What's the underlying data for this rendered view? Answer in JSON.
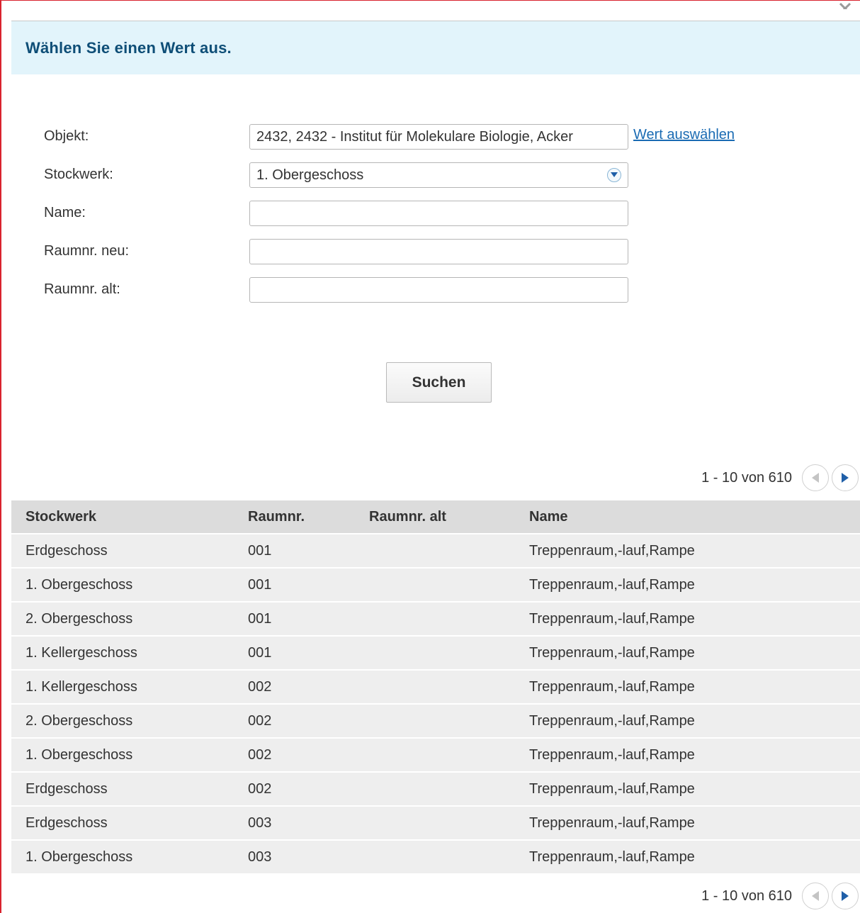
{
  "dialog": {
    "title": "Wählen Sie einen Wert aus."
  },
  "form": {
    "objekt": {
      "label": "Objekt:",
      "value": "2432, 2432 - Institut für Molekulare Biologie, Acker",
      "link": "Wert auswählen"
    },
    "stockwerk": {
      "label": "Stockwerk:",
      "value": "1. Obergeschoss"
    },
    "name": {
      "label": "Name:",
      "value": ""
    },
    "raumnr_neu": {
      "label": "Raumnr. neu:",
      "value": ""
    },
    "raumnr_alt": {
      "label": "Raumnr. alt:",
      "value": ""
    }
  },
  "search_button": "Suchen",
  "pager": {
    "text": "1 - 10 von 610"
  },
  "table": {
    "headers": [
      "Stockwerk",
      "Raumnr.",
      "Raumnr. alt",
      "Name"
    ],
    "rows": [
      [
        "Erdgeschoss",
        "001",
        "",
        "Treppenraum,-lauf,Rampe"
      ],
      [
        "1. Obergeschoss",
        "001",
        "",
        "Treppenraum,-lauf,Rampe"
      ],
      [
        "2. Obergeschoss",
        "001",
        "",
        "Treppenraum,-lauf,Rampe"
      ],
      [
        "1. Kellergeschoss",
        "001",
        "",
        "Treppenraum,-lauf,Rampe"
      ],
      [
        "1. Kellergeschoss",
        "002",
        "",
        "Treppenraum,-lauf,Rampe"
      ],
      [
        "2. Obergeschoss",
        "002",
        "",
        "Treppenraum,-lauf,Rampe"
      ],
      [
        "1. Obergeschoss",
        "002",
        "",
        "Treppenraum,-lauf,Rampe"
      ],
      [
        "Erdgeschoss",
        "002",
        "",
        "Treppenraum,-lauf,Rampe"
      ],
      [
        "Erdgeschoss",
        "003",
        "",
        "Treppenraum,-lauf,Rampe"
      ],
      [
        "1. Obergeschoss",
        "003",
        "",
        "Treppenraum,-lauf,Rampe"
      ]
    ]
  },
  "colors": {
    "header_bg": "#e2f4fb",
    "title": "#0e4e77",
    "link": "#1a6bb3",
    "frame_border": "#d9232e",
    "pager_arrow": "#1f5fa8"
  },
  "icons": [
    "close-icon",
    "dropdown-arrow-icon",
    "previous-page-icon",
    "next-page-icon"
  ]
}
